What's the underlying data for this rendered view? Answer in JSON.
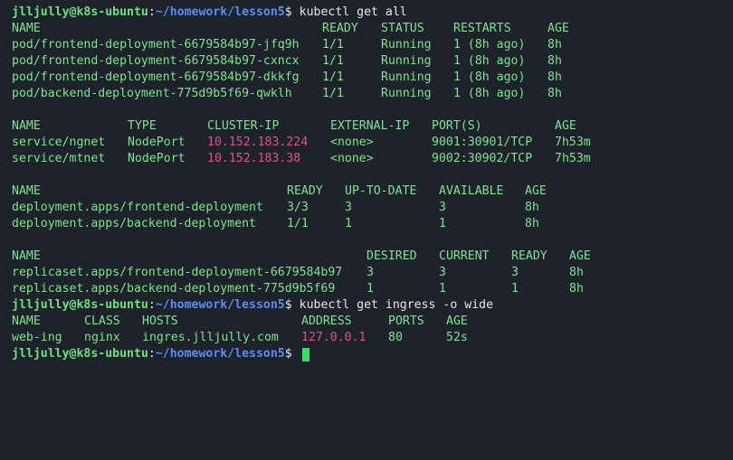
{
  "prompt": {
    "user_host": "jlljully@k8s-ubuntu",
    "colon": ":",
    "path": "~/homework/lesson5",
    "symbol": "$"
  },
  "cmd1": "kubectl get all",
  "cmd2": "kubectl get ingress -o wide",
  "pods": {
    "headers": [
      "NAME",
      "READY",
      "STATUS",
      "RESTARTS",
      "AGE"
    ],
    "rows": [
      [
        "pod/frontend-deployment-6679584b97-jfq9h",
        "1/1",
        "Running",
        "1 (8h ago)",
        "8h"
      ],
      [
        "pod/frontend-deployment-6679584b97-cxncx",
        "1/1",
        "Running",
        "1 (8h ago)",
        "8h"
      ],
      [
        "pod/frontend-deployment-6679584b97-dkkfg",
        "1/1",
        "Running",
        "1 (8h ago)",
        "8h"
      ],
      [
        "pod/backend-deployment-775d9b5f69-qwklh",
        "1/1",
        "Running",
        "1 (8h ago)",
        "8h"
      ]
    ]
  },
  "services": {
    "headers": [
      "NAME",
      "TYPE",
      "CLUSTER-IP",
      "EXTERNAL-IP",
      "PORT(S)",
      "AGE"
    ],
    "rows": [
      [
        "service/ngnet",
        "NodePort",
        "10.152.183.224",
        "<none>",
        "9001:30901/TCP",
        "7h53m"
      ],
      [
        "service/mtnet",
        "NodePort",
        "10.152.183.38",
        "<none>",
        "9002:30902/TCP",
        "7h53m"
      ]
    ]
  },
  "deployments": {
    "headers": [
      "NAME",
      "READY",
      "UP-TO-DATE",
      "AVAILABLE",
      "AGE"
    ],
    "rows": [
      [
        "deployment.apps/frontend-deployment",
        "3/3",
        "3",
        "3",
        "8h"
      ],
      [
        "deployment.apps/backend-deployment",
        "1/1",
        "1",
        "1",
        "8h"
      ]
    ]
  },
  "replicasets": {
    "headers": [
      "NAME",
      "DESIRED",
      "CURRENT",
      "READY",
      "AGE"
    ],
    "rows": [
      [
        "replicaset.apps/frontend-deployment-6679584b97",
        "3",
        "3",
        "3",
        "8h"
      ],
      [
        "replicaset.apps/backend-deployment-775d9b5f69",
        "1",
        "1",
        "1",
        "8h"
      ]
    ]
  },
  "ingress": {
    "headers": [
      "NAME",
      "CLASS",
      "HOSTS",
      "ADDRESS",
      "PORTS",
      "AGE"
    ],
    "rows": [
      [
        "web-ing",
        "nginx",
        "ingres.jlljully.com",
        "127.0.0.1",
        "80",
        "52s"
      ]
    ]
  },
  "colors": {
    "background": "#1e222a",
    "output_text": "#7fe38f",
    "ip_highlight": "#e0528a",
    "prompt_user": "#6fe07f",
    "prompt_path": "#5c8df2",
    "cursor": "#35e06a"
  }
}
